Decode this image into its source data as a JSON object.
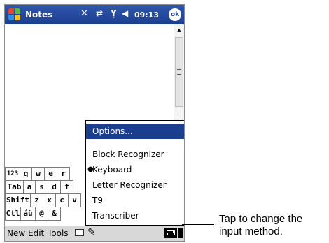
{
  "window": {
    "title": "Notes",
    "time": "09:13",
    "ok_label": "ok"
  },
  "status_icons": [
    "signal-off-icon",
    "connectivity-icon",
    "antenna-icon",
    "speaker-icon"
  ],
  "keyboard": {
    "rows": [
      [
        "123",
        "q",
        "w",
        "e",
        "r"
      ],
      [
        "Tab",
        "a",
        "s",
        "d",
        "f"
      ],
      [
        "Shift",
        "z",
        "x",
        "c",
        "v"
      ],
      [
        "Ctl",
        "áü",
        "@",
        "&"
      ]
    ]
  },
  "input_menu": {
    "options_label": "Options...",
    "items": [
      {
        "label": "Block Recognizer",
        "checked": false
      },
      {
        "label": "Keyboard",
        "checked": true
      },
      {
        "label": "Letter Recognizer",
        "checked": false
      },
      {
        "label": "T9",
        "checked": false
      },
      {
        "label": "Transcriber",
        "checked": false
      }
    ]
  },
  "menubar": {
    "new": "New",
    "edit": "Edit",
    "tools": "Tools"
  },
  "callout": {
    "line1": "Tap to change the",
    "line2": "input method."
  },
  "colors": {
    "titlebar": "#1c3e8f",
    "highlight": "#1c3e8f"
  }
}
